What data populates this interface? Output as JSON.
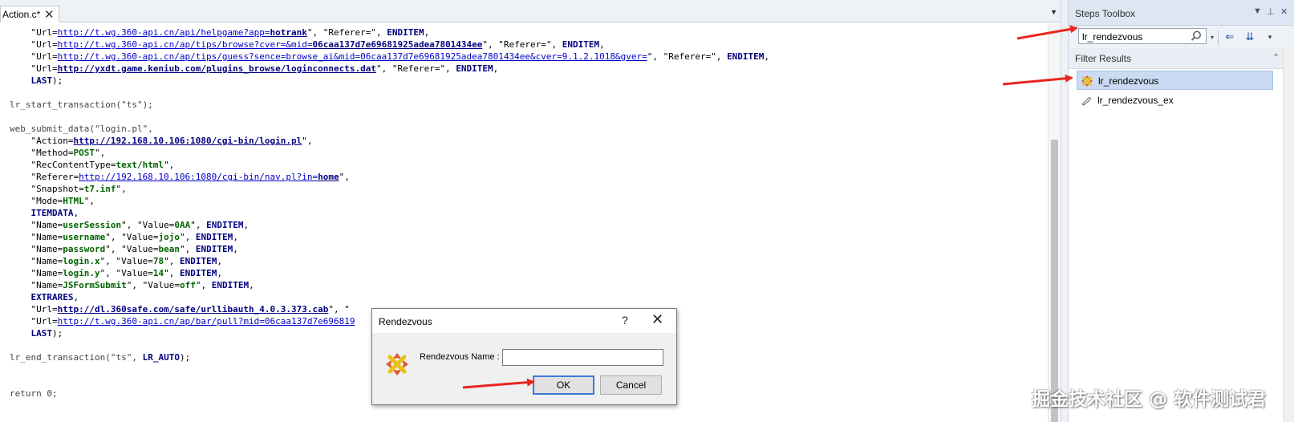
{
  "editor": {
    "tab_label": "Action.c*",
    "tab_close": "✕",
    "tab_menu": "▼"
  },
  "dialog": {
    "title": "Rendezvous",
    "help": "?",
    "close": "✕",
    "name_label": "Rendezvous Name :",
    "name_value": "",
    "ok_label": "OK",
    "cancel_label": "Cancel"
  },
  "toolbox": {
    "title": "Steps Toolbox",
    "search_value": "lr_rendezvous",
    "filter_results_label": "Filter Results",
    "items": [
      {
        "label": "lr_rendezvous",
        "selected": true,
        "icon": "rendezvous-icon"
      },
      {
        "label": "lr_rendezvous_ex",
        "selected": false,
        "icon": "function-icon"
      }
    ]
  },
  "watermark": "掘金技术社区 @ 软件测试君",
  "colors": {
    "string": "#000000",
    "url": "#0000cc",
    "keyword": "#000080",
    "value": "#006400",
    "selection": "#c9daf2",
    "arrow": "#e8251f"
  },
  "code_lines": [
    [
      [
        "s",
        "    \"Url="
      ],
      [
        "u",
        "http://t.wg.360-api.cn/api/helpgame?app="
      ],
      [
        "u k",
        "hotrank"
      ],
      [
        "s",
        "\", \"Referer=\", "
      ],
      [
        "k",
        "ENDITEM"
      ],
      [
        "s",
        ","
      ]
    ],
    [
      [
        "s",
        "    \"Url="
      ],
      [
        "u",
        "http://t.wg.360-api.cn/ap/tips/browse?cver=&mid="
      ],
      [
        "u k",
        "06caa137d7e69681925adea7801434ee"
      ],
      [
        "s",
        "\", \"Referer=\", "
      ],
      [
        "k",
        "ENDITEM"
      ],
      [
        "s",
        ","
      ]
    ],
    [
      [
        "s",
        "    \"Url="
      ],
      [
        "u",
        "http://t.wg.360-api.cn/ap/tips/guess?sence=browse_ai&mid=06caa137d7e69681925adea7801434ee&cver=9.1.2.1018&gver="
      ],
      [
        "s",
        "\", \"Referer=\", "
      ],
      [
        "k",
        "ENDITEM"
      ],
      [
        "s",
        ","
      ]
    ],
    [
      [
        "s",
        "    \"Url="
      ],
      [
        "u k",
        "http://yxdt.game.keniub.com/plugins_browse/loginconnects.dat"
      ],
      [
        "s",
        "\", \"Referer=\", "
      ],
      [
        "k",
        "ENDITEM"
      ],
      [
        "s",
        ","
      ]
    ],
    [
      [
        "s",
        "    "
      ],
      [
        "k",
        "LAST"
      ],
      [
        "s",
        ");"
      ]
    ],
    [],
    [
      [
        "f",
        "lr_start_transaction(\"ts\");"
      ]
    ],
    [],
    [
      [
        "f",
        "web_submit_data(\"login.pl\","
      ]
    ],
    [
      [
        "s",
        "    \"Action="
      ],
      [
        "u k",
        "http://192.168.10.106:1080/cgi-bin/login.pl"
      ],
      [
        "s",
        "\","
      ]
    ],
    [
      [
        "s",
        "    \"Method="
      ],
      [
        "g",
        "POST"
      ],
      [
        "s",
        "\","
      ]
    ],
    [
      [
        "s",
        "    \"RecContentType="
      ],
      [
        "g",
        "text/html"
      ],
      [
        "s",
        "\","
      ]
    ],
    [
      [
        "s",
        "    \"Referer="
      ],
      [
        "u",
        "http://192.168.10.106:1080/cgi-bin/nav.pl?in="
      ],
      [
        "u k",
        "home"
      ],
      [
        "s",
        "\","
      ]
    ],
    [
      [
        "s",
        "    \"Snapshot="
      ],
      [
        "g",
        "t7.inf"
      ],
      [
        "s",
        "\","
      ]
    ],
    [
      [
        "s",
        "    \"Mode="
      ],
      [
        "g",
        "HTML"
      ],
      [
        "s",
        "\","
      ]
    ],
    [
      [
        "s",
        "    "
      ],
      [
        "k",
        "ITEMDATA"
      ],
      [
        "s",
        ","
      ]
    ],
    [
      [
        "s",
        "    \"Name="
      ],
      [
        "g",
        "userSession"
      ],
      [
        "s",
        "\", \"Value="
      ],
      [
        "g",
        "0AA"
      ],
      [
        "s",
        "\", "
      ],
      [
        "k",
        "ENDITEM"
      ],
      [
        "s",
        ","
      ]
    ],
    [
      [
        "s",
        "    \"Name="
      ],
      [
        "g",
        "username"
      ],
      [
        "s",
        "\", \"Value="
      ],
      [
        "g",
        "jojo"
      ],
      [
        "s",
        "\", "
      ],
      [
        "k",
        "ENDITEM"
      ],
      [
        "s",
        ","
      ]
    ],
    [
      [
        "s",
        "    \"Name="
      ],
      [
        "g",
        "password"
      ],
      [
        "s",
        "\", \"Value="
      ],
      [
        "g",
        "bean"
      ],
      [
        "s",
        "\", "
      ],
      [
        "k",
        "ENDITEM"
      ],
      [
        "s",
        ","
      ]
    ],
    [
      [
        "s",
        "    \"Name="
      ],
      [
        "g",
        "login.x"
      ],
      [
        "s",
        "\", \"Value="
      ],
      [
        "g",
        "78"
      ],
      [
        "s",
        "\", "
      ],
      [
        "k",
        "ENDITEM"
      ],
      [
        "s",
        ","
      ]
    ],
    [
      [
        "s",
        "    \"Name="
      ],
      [
        "g",
        "login.y"
      ],
      [
        "s",
        "\", \"Value="
      ],
      [
        "g",
        "14"
      ],
      [
        "s",
        "\", "
      ],
      [
        "k",
        "ENDITEM"
      ],
      [
        "s",
        ","
      ]
    ],
    [
      [
        "s",
        "    \"Name="
      ],
      [
        "g",
        "JSFormSubmit"
      ],
      [
        "s",
        "\", \"Value="
      ],
      [
        "g",
        "off"
      ],
      [
        "s",
        "\", "
      ],
      [
        "k",
        "ENDITEM"
      ],
      [
        "s",
        ","
      ]
    ],
    [
      [
        "s",
        "    "
      ],
      [
        "k",
        "EXTRARES"
      ],
      [
        "s",
        ","
      ]
    ],
    [
      [
        "s",
        "    \"Url="
      ],
      [
        "u k",
        "http://dl.360safe.com/safe/urllibauth_4.0.3.373.cab"
      ],
      [
        "s",
        "\", \""
      ]
    ],
    [
      [
        "s",
        "    \"Url="
      ],
      [
        "u",
        "http://t.wg.360-api.cn/ap/bar/pull?mid=06caa137d7e696819"
      ]
    ],
    [
      [
        "s",
        "    "
      ],
      [
        "k",
        "LAST"
      ],
      [
        "s",
        ");"
      ]
    ],
    [],
    [
      [
        "f",
        "lr_end_transaction(\"ts\", "
      ],
      [
        "k",
        "LR_AUTO"
      ],
      [
        "s",
        ");"
      ]
    ],
    [],
    [],
    [
      [
        "f",
        "return 0;"
      ]
    ]
  ]
}
